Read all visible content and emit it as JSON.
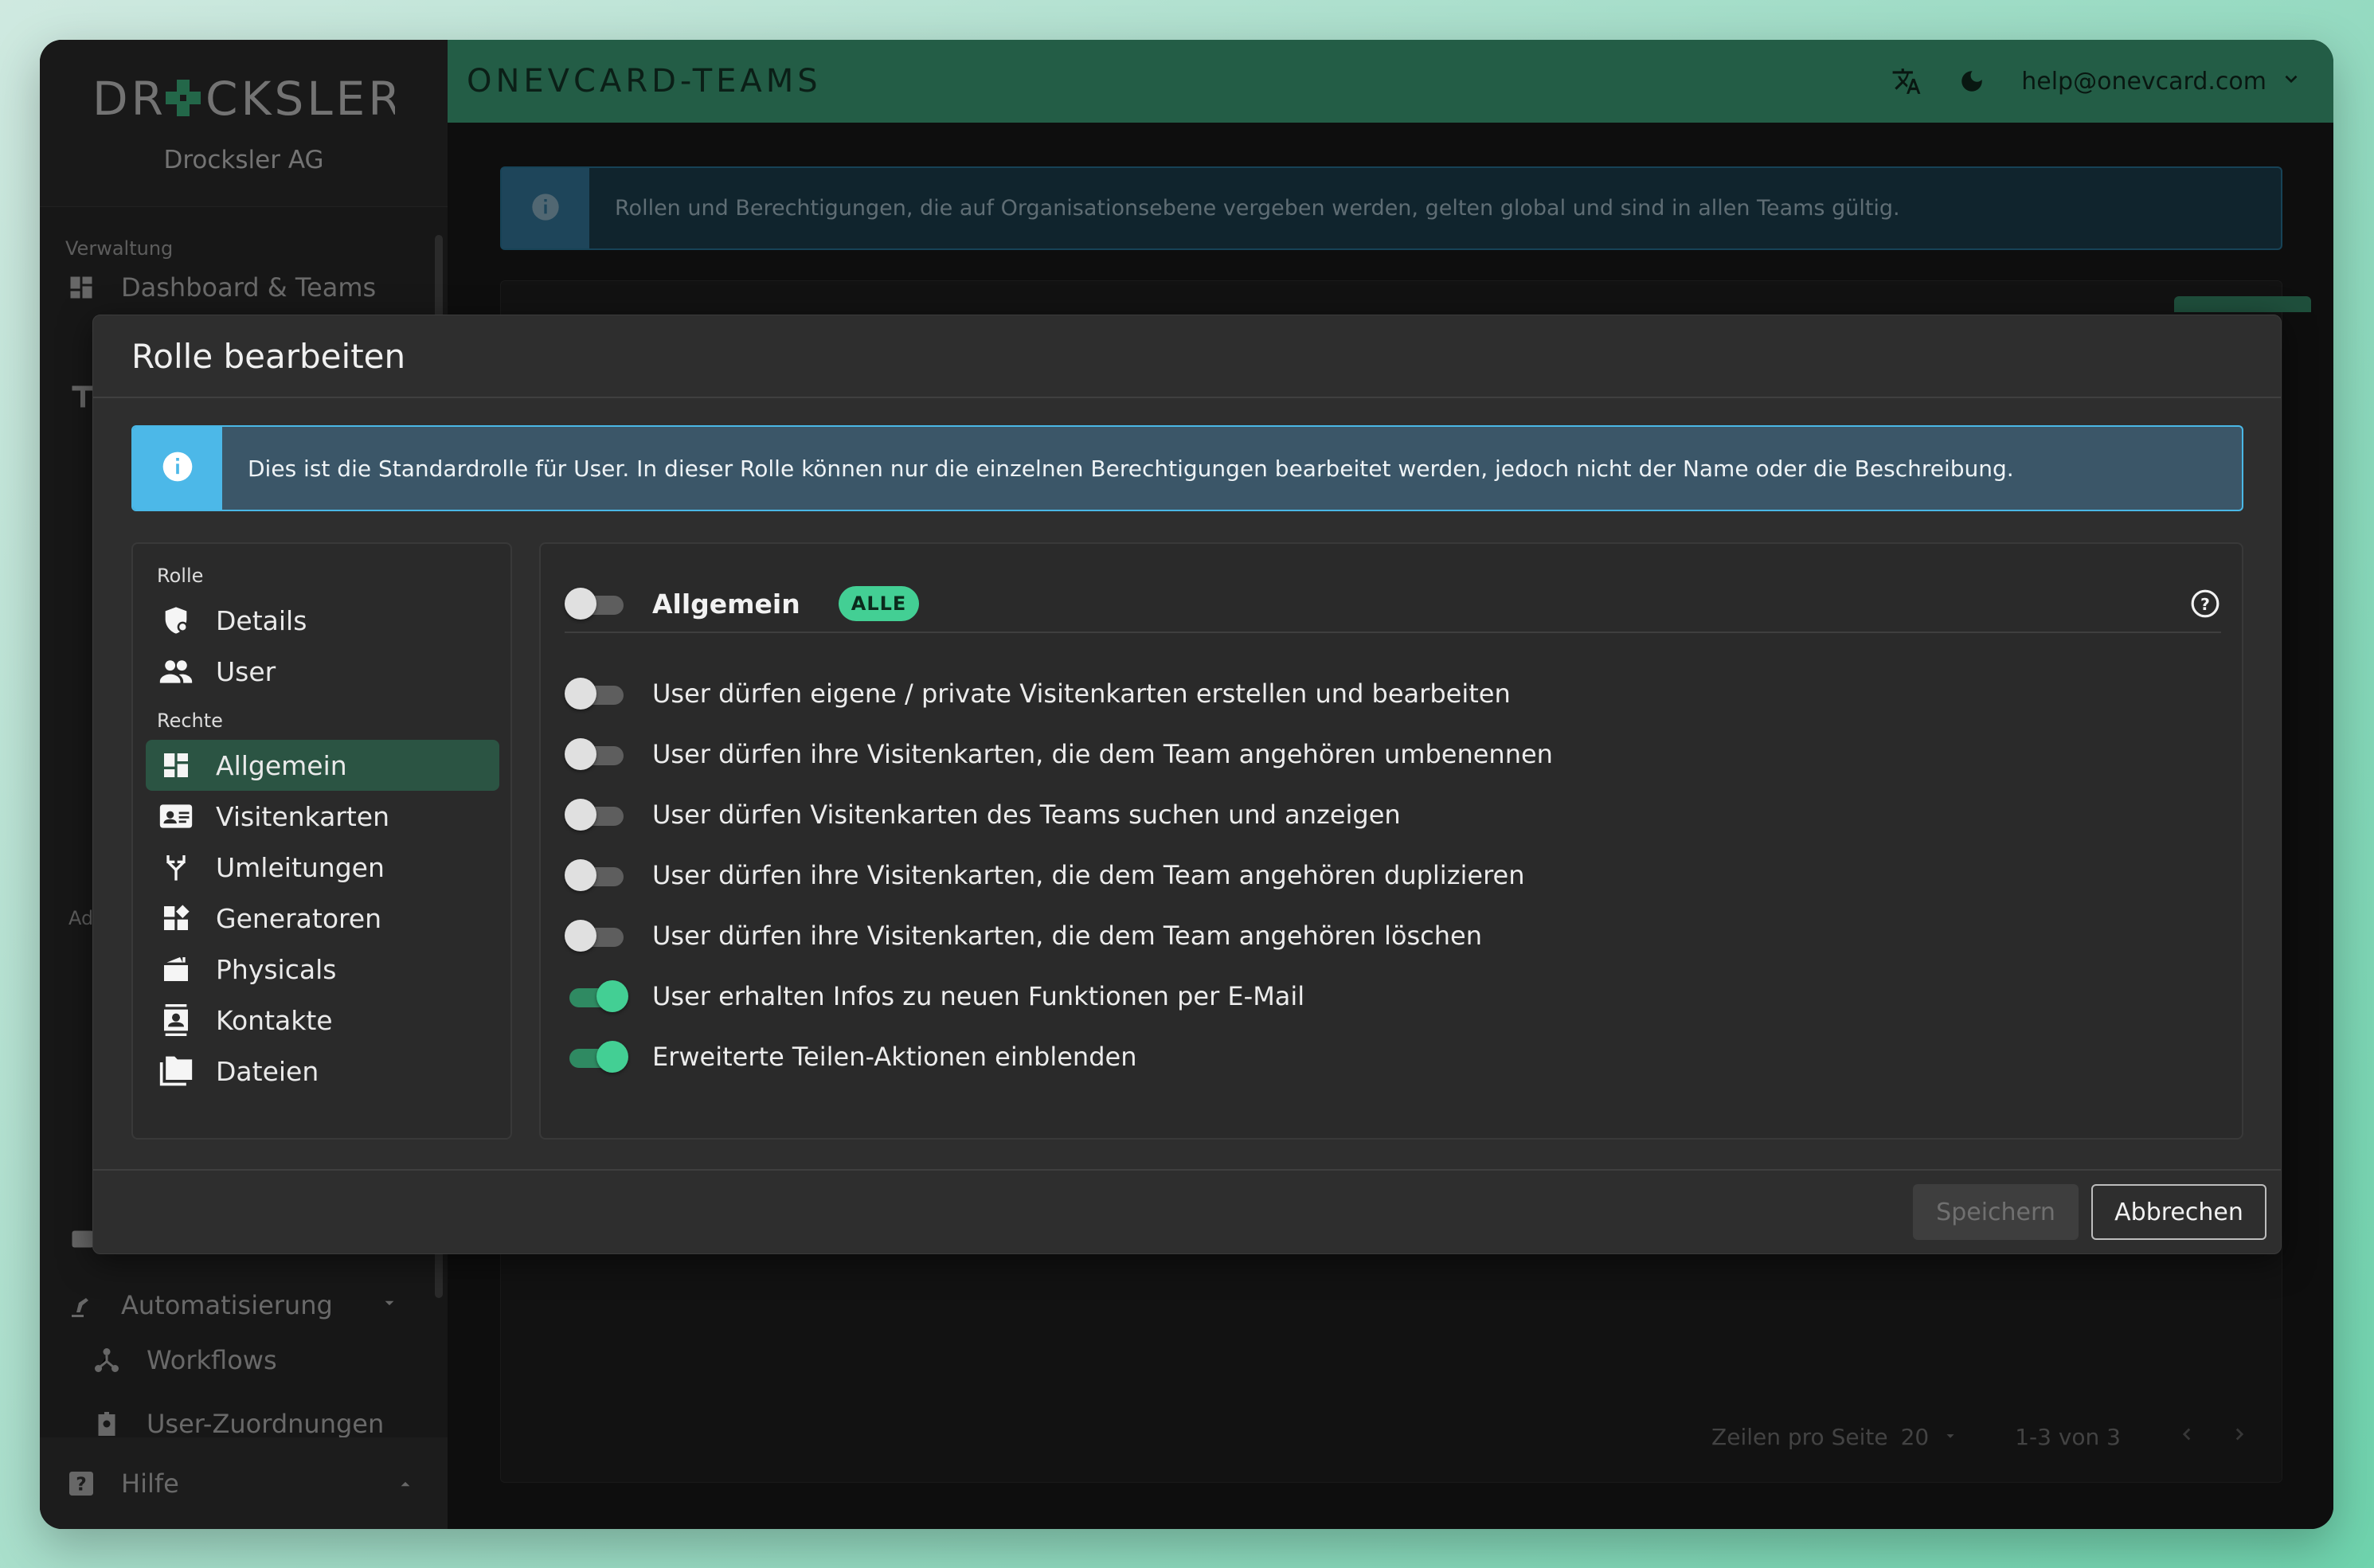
{
  "brand": {
    "logo_text": "DRÖCKSLER",
    "company": "Drocksler AG"
  },
  "sidebar": {
    "section_verwaltung": "Verwaltung",
    "item_dashboard": "Dashboard & Teams",
    "section_ad_partial": "Ad",
    "item_automatisierung": "Automatisierung",
    "item_workflows": "Workflows",
    "item_user_zuordnungen": "User-Zuordnungen",
    "help": "Hilfe"
  },
  "topbar": {
    "product": "ONEVCARD-TEAMS",
    "email": "help@onevcard.com"
  },
  "background": {
    "alert_text": "Rollen und Berechtigungen, die auf Organisationsebene vergeben werden, gelten global und sind in allen Teams gültig.",
    "rows_per_page_label": "Zeilen pro Seite",
    "rows_per_page_value": "20",
    "range": "1-3 von 3"
  },
  "dialog": {
    "title": "Rolle bearbeiten",
    "alert_text": "Dies ist die Standardrolle für User. In dieser Rolle können nur die einzelnen Berechtigungen bearbeitet werden, jedoch nicht der Name oder die Beschreibung.",
    "nav": {
      "section_rolle": "Rolle",
      "item_details": "Details",
      "item_user": "User",
      "section_rechte": "Rechte",
      "item_allgemein": "Allgemein",
      "item_visitenkarten": "Visitenkarten",
      "item_umleitungen": "Umleitungen",
      "item_generatoren": "Generatoren",
      "item_physicals": "Physicals",
      "item_kontakte": "Kontakte",
      "item_dateien": "Dateien"
    },
    "permissions": {
      "header_label": "Allgemein",
      "header_badge": "ALLE",
      "header_on": false,
      "items": [
        {
          "label": "User dürfen eigene / private Visitenkarten erstellen und bearbeiten",
          "on": false
        },
        {
          "label": "User dürfen ihre Visitenkarten, die dem Team angehören umbenennen",
          "on": false
        },
        {
          "label": "User dürfen Visitenkarten des Teams suchen und anzeigen",
          "on": false
        },
        {
          "label": "User dürfen ihre Visitenkarten, die dem Team angehören duplizieren",
          "on": false
        },
        {
          "label": "User dürfen ihre Visitenkarten, die dem Team angehören löschen",
          "on": false
        },
        {
          "label": "User erhalten Infos zu neuen Funktionen per E-Mail",
          "on": true
        },
        {
          "label": "Erweiterte Teilen-Aktionen einblenden",
          "on": true
        }
      ]
    },
    "buttons": {
      "save": "Speichern",
      "cancel": "Abbrechen"
    }
  },
  "colors": {
    "accent": "#43cf94",
    "topbar": "#2f7d5e",
    "info": "#4cb8e8"
  }
}
